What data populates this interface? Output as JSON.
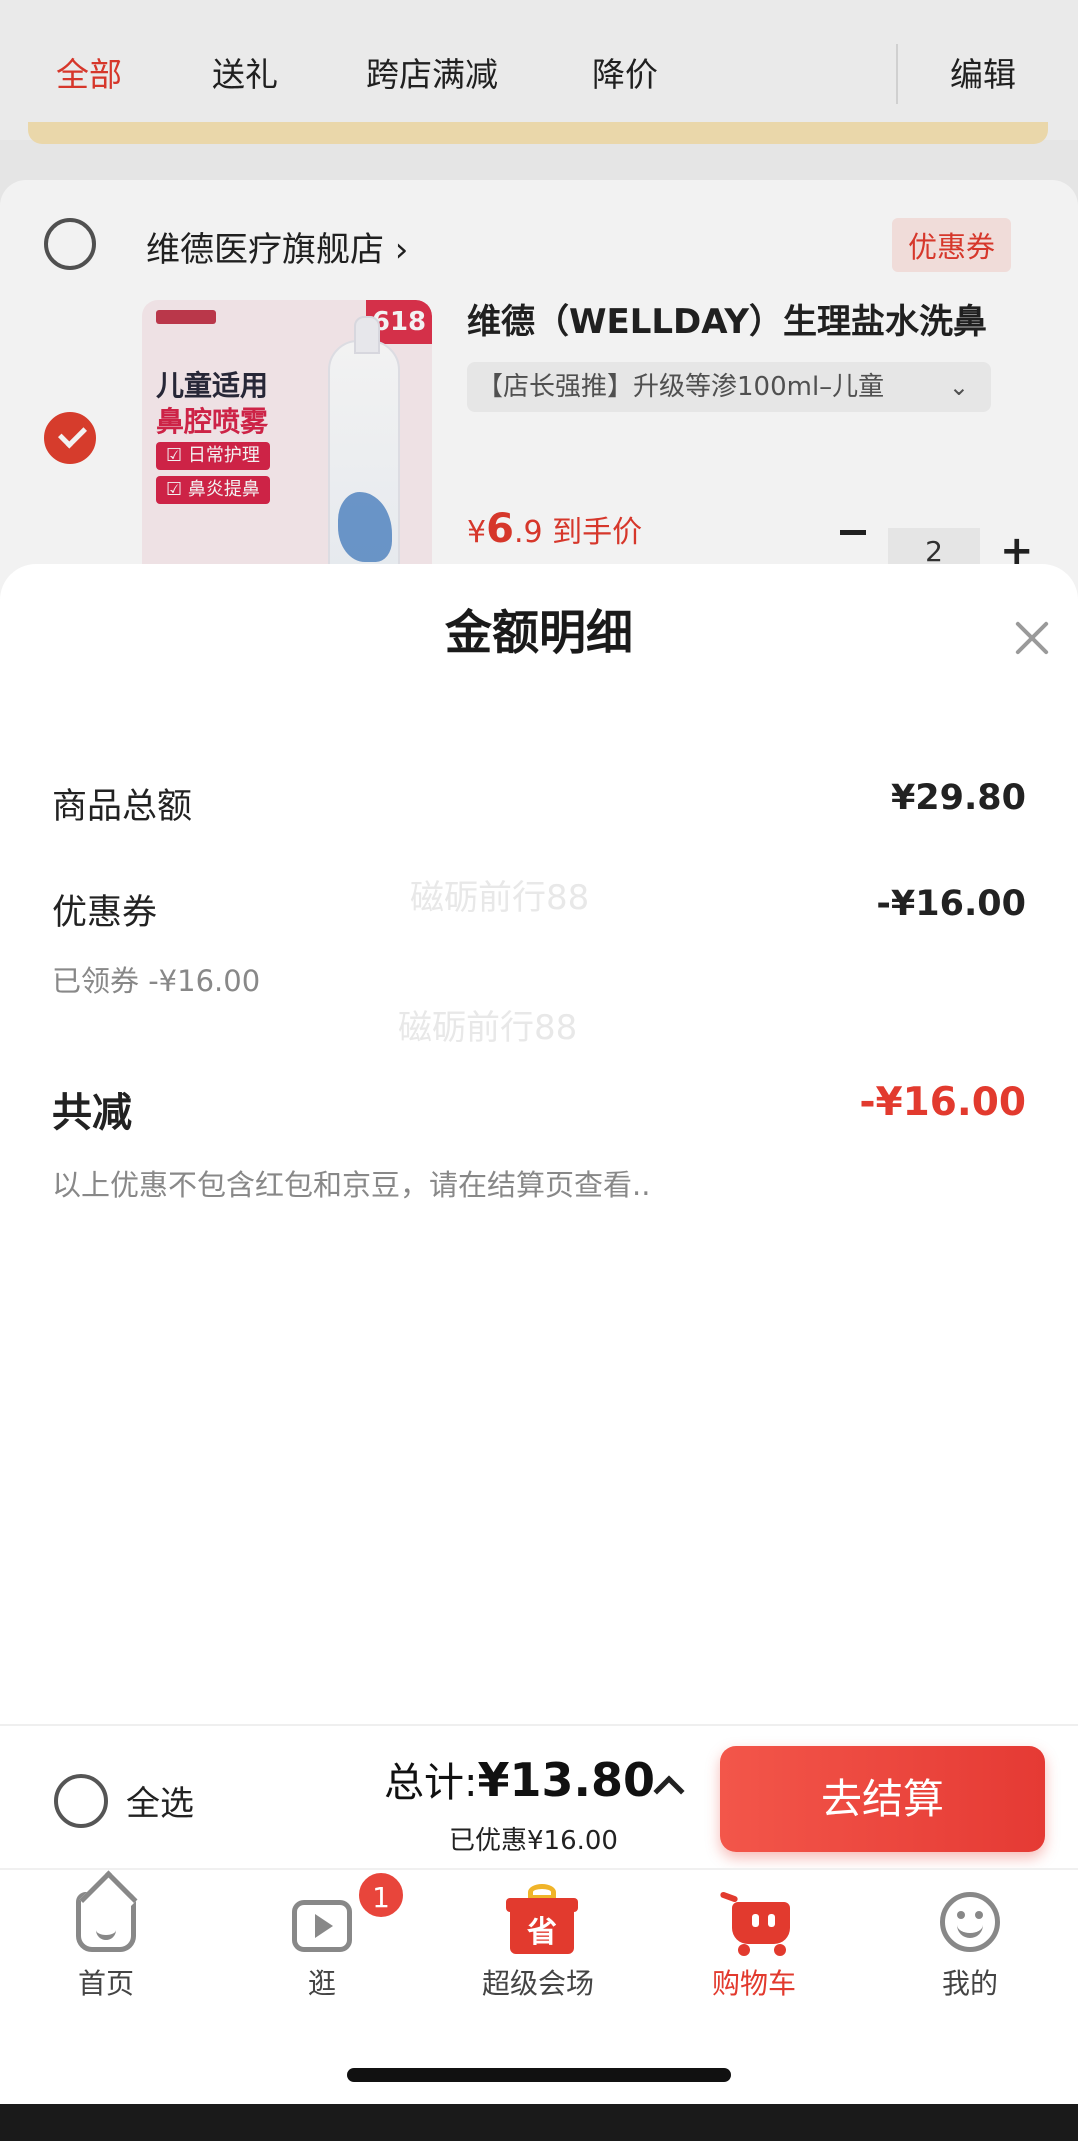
{
  "filter_bar": {
    "tabs": [
      "全部",
      "送礼",
      "跨店满减",
      "降价"
    ],
    "active_index": 0,
    "edit_label": "编辑"
  },
  "store": {
    "name": "维德医疗旗舰店 ›",
    "coupon_tag": "优惠券",
    "selected": false
  },
  "product": {
    "selected": true,
    "title": "维德（WELLDAY）生理盐水洗鼻",
    "spec": "【店长强推】升级等渗100ml–儿童",
    "spec_caret": "⌄",
    "price_symbol": "¥",
    "price_int": "6",
    "price_dec": ".9",
    "price_suffix": " 到手价",
    "quantity": "2",
    "minus_label": "−",
    "plus_label": "+",
    "image": {
      "brand": "wellday",
      "badge": "618",
      "line1": "儿童适用",
      "line2": "鼻腔喷雾",
      "tag1": "☑ 日常护理",
      "tag2": "☑ 鼻炎提鼻"
    }
  },
  "sheet": {
    "title": "金额明细",
    "close_icon": "close-icon",
    "rows": {
      "goods_total_label": "商品总额",
      "goods_total_value": "¥29.80",
      "coupon_label": "优惠券",
      "coupon_value": "-¥16.00",
      "coupon_sub": "已领券 -¥16.00",
      "reduction_label": "共减",
      "reduction_value": "-¥16.00",
      "note": "以上优惠不包含红包和京豆，请在结算页查看.."
    },
    "watermark": "磁砺前行88"
  },
  "checkout": {
    "select_all": "全选",
    "total_prefix": "总计:",
    "total_amount": "¥13.80",
    "saved": "已优惠¥16.00",
    "button": "去结算",
    "expand_icon": "chevron-up-icon"
  },
  "tabbar": {
    "items": [
      {
        "label": "首页",
        "icon": "home-icon"
      },
      {
        "label": "逛",
        "icon": "video-icon",
        "badge": "1"
      },
      {
        "label": "超级会场",
        "icon": "gift-icon",
        "icon_text": "省"
      },
      {
        "label": "购物车",
        "icon": "cart-icon"
      },
      {
        "label": "我的",
        "icon": "smiley-icon"
      }
    ],
    "active_index": 3
  },
  "colors": {
    "accent": "#e23a2e",
    "coupon_tag_bg": "#fde8e5",
    "text": "#222222",
    "muted": "#888888"
  }
}
